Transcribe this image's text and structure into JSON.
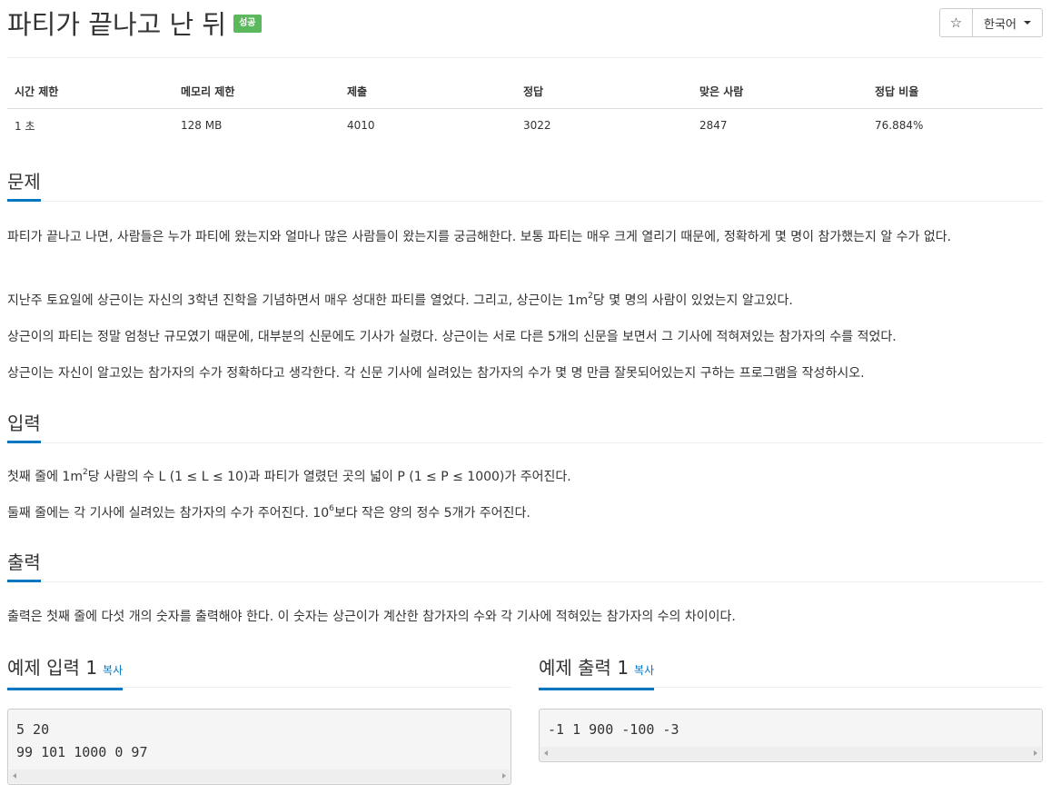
{
  "problem": {
    "title": "파티가 끝나고 난 뒤",
    "status_badge": "성공"
  },
  "header_buttons": {
    "star_glyph": "☆",
    "language": "한국어"
  },
  "info_table": {
    "headers": [
      "시간 제한",
      "메모리 제한",
      "제출",
      "정답",
      "맞은 사람",
      "정답 비율"
    ],
    "values": [
      "1 초",
      "128 MB",
      "4010",
      "3022",
      "2847",
      "76.884%"
    ]
  },
  "sections": {
    "problem_heading": "문제",
    "problem_p1": "파티가 끝나고 나면, 사람들은 누가 파티에 왔는지와 얼마나 많은 사람들이 왔는지를 궁금해한다. 보통 파티는 매우 크게 열리기 때문에, 정확하게 몇 명이 참가했는지 알 수가 없다.",
    "problem_p2_before": "지난주 토요일에 상근이는 자신의 3학년 진학을 기념하면서 매우 성대한 파티를 열었다. 그리고, 상근이는 1m",
    "problem_p2_sup": "2",
    "problem_p2_after": "당 몇 명의 사람이 있었는지 알고있다.",
    "problem_p3": "상근이의 파티는 정말 엄청난 규모였기 때문에, 대부분의 신문에도 기사가 실렸다. 상근이는 서로 다른 5개의 신문을 보면서 그 기사에 적혀져있는 참가자의 수를 적었다.",
    "problem_p4": "상근이는 자신이 알고있는 참가자의 수가 정확하다고 생각한다. 각 신문 기사에 실려있는 참가자의 수가 몇 명 만큼 잘못되어있는지 구하는 프로그램을 작성하시오.",
    "input_heading": "입력",
    "input_p1_before": "첫째 줄에 1m",
    "input_p1_sup": "2",
    "input_p1_after": "당 사람의 수 L (1 ≤ L ≤ 10)과 파티가 열렸던 곳의 넓이 P (1 ≤ P ≤ 1000)가 주어진다.",
    "input_p2_before": "둘째 줄에는 각 기사에 실려있는 참가자의 수가 주어진다. 10",
    "input_p2_sup": "6",
    "input_p2_after": "보다 작은 양의 정수 5개가 주어진다.",
    "output_heading": "출력",
    "output_p1": "출력은 첫째 줄에 다섯 개의 숫자를 출력해야 한다. 이 숫자는 상근이가 계산한 참가자의 수와  각 기사에 적혀있는 참가자의 수의 차이이다."
  },
  "samples": {
    "input_heading": "예제 입력 1",
    "input_copy": "복사",
    "input_code": "5 20\n99 101 1000 0 97",
    "output_heading": "예제 출력 1",
    "output_copy": "복사",
    "output_code": "-1 1 900 -100 -3"
  }
}
